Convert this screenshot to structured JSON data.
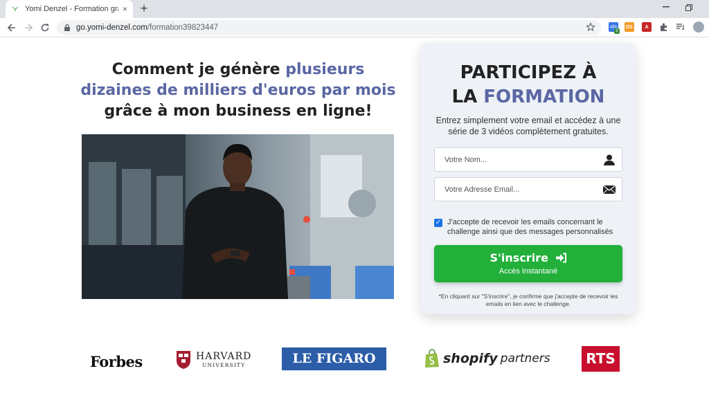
{
  "browser": {
    "tab_title": "Yomi Denzel - Formation gratuite",
    "tab_close": "×",
    "new_tab": "+",
    "url_host": "go.yomi-denzel.com",
    "url_path": "/formation39823447",
    "extensions": [
      {
        "name": "code-extension",
        "color": "#3b78e7",
        "label": "</>",
        "badge": "2"
      },
      {
        "name": "ds-extension",
        "color": "#f29a28",
        "label": "DS"
      },
      {
        "name": "pdf-extension",
        "color": "#c62828",
        "label": "A"
      }
    ]
  },
  "headline": {
    "part1": "Comment je génère ",
    "accent": "plusieurs dizaines de milliers d'euros par mois",
    "part2": " grâce à mon business en ligne!"
  },
  "form": {
    "title_line1": "PARTICIPEZ À",
    "title_la": "LA ",
    "title_accent": "FORMATION",
    "subtitle": "Entrez simplement votre email et accédez à une série de 3 vidéos complètement gratuites.",
    "name_placeholder": "Votre Nom...",
    "email_placeholder": "Votre Adresse Email...",
    "consent_checked": true,
    "consent_text": "J'accepte de recevoir les emails concernant le challenge ainsi que des messages personnalisés",
    "cta_label": "S'inscrire",
    "cta_sub": "Accès Instantané",
    "disclaimer": "*En cliquant sur \"S'inscrire\", je confirme que j'accepte de recevoir les emails en lien avec le challenge."
  },
  "logos": {
    "forbes": "Forbes",
    "harvard_1": "HARVARD",
    "harvard_2": "UNIVERSITY",
    "figaro": "LE FIGARO",
    "shopify_1": "shopify",
    "shopify_2": "partners",
    "rts": "RTS"
  },
  "colors": {
    "accent": "#5a67a3",
    "cta_green": "#22b03b",
    "figaro_blue": "#2c5da8",
    "rts_red": "#c8102e",
    "harvard_crimson": "#a51c30",
    "shopify_green": "#95bf47"
  }
}
